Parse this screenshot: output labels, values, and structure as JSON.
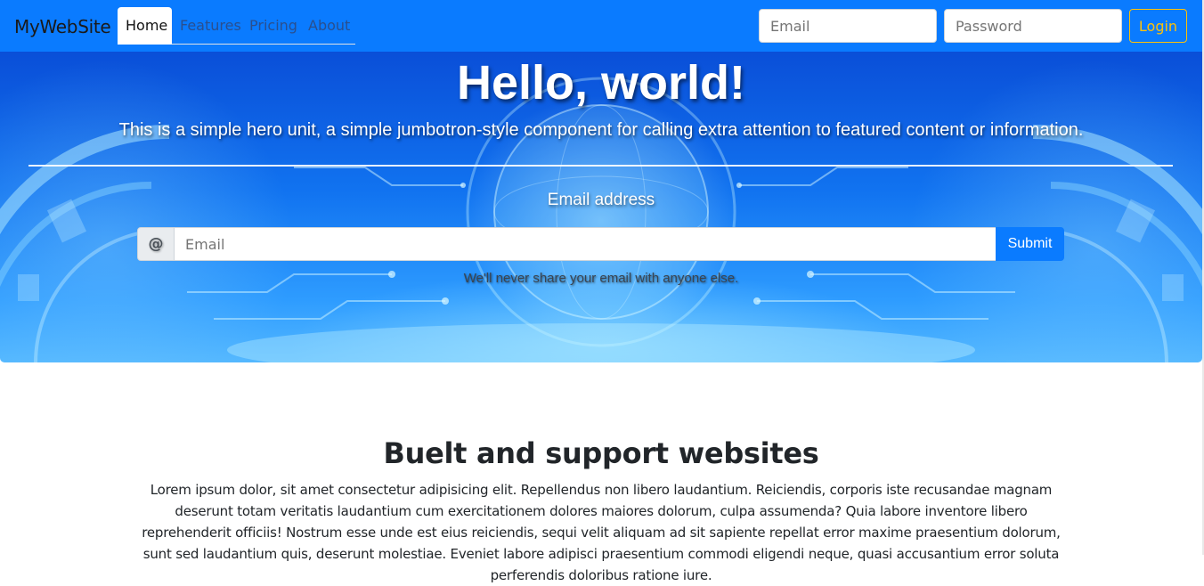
{
  "navbar": {
    "brand": "MyWebSite",
    "tabs": [
      {
        "label": "Home",
        "active": true
      },
      {
        "label": "Features",
        "active": false
      },
      {
        "label": "Pricing",
        "active": false
      },
      {
        "label": "About",
        "active": false
      }
    ],
    "email_placeholder": "Email",
    "password_placeholder": "Password",
    "login_label": "Login"
  },
  "hero": {
    "title": "Hello, world!",
    "lead": "This is a simple hero unit, a simple jumbotron-style component for calling extra attention to featured content or information.",
    "email_label": "Email address",
    "prepend": "@",
    "email_placeholder": "Email",
    "submit_label": "Submit",
    "help_text": "We'll never share your email with anyone else."
  },
  "section": {
    "title": "Buelt and support websites",
    "text": "Lorem ipsum dolor, sit amet consectetur adipisicing elit. Repellendus non libero laudantium. Reiciendis, corporis iste recusandae magnam deserunt totam veritatis laudantium cum exercitationem dolores maiores dolorum, culpa assumenda? Quia labore inventore libero reprehenderit officiis! Nostrum esse unde est eius reiciendis, sequi velit aliquam ad sit sapiente repellat error maxime praesentium dolorum, sunt sed laudantium quis, deserunt molestiae. Eveniet labore adipisci praesentium commodi eligendi neque, quasi accusantium error soluta perferendis doloribus ratione iure."
  },
  "colors": {
    "primary": "#0a7bff",
    "warning": "#ffc107"
  }
}
